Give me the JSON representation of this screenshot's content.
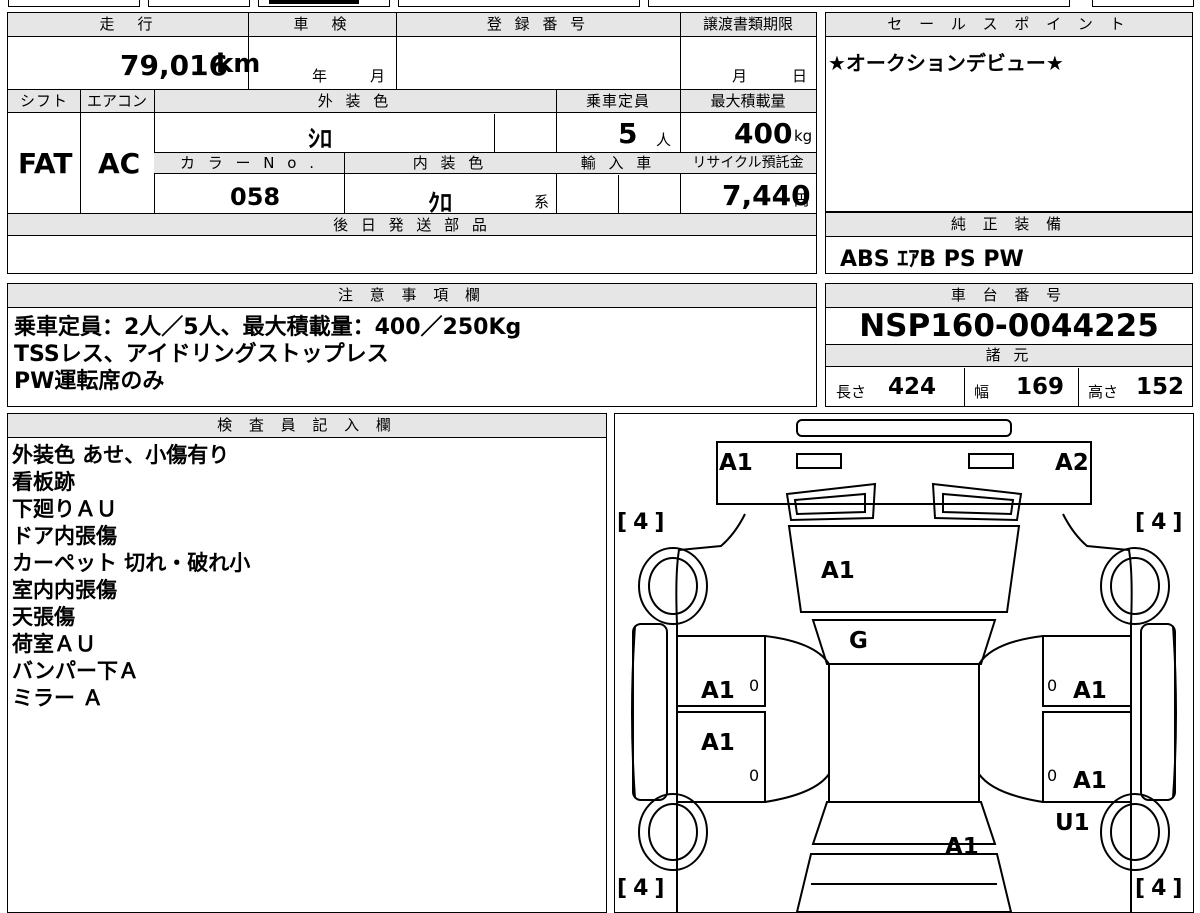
{
  "top_table": {
    "headers": {
      "mileage": "走　行",
      "inspection": "車　検",
      "registration": "登 録 番 号",
      "transfer_deadline": "譲渡書類期限",
      "shift": "シフト",
      "aircon": "エアコン",
      "exterior_color": "外 装 色",
      "capacity": "乗車定員",
      "max_load": "最大積載量",
      "color_no": "カ ラ ー N o .",
      "interior_color": "内 装 色",
      "import": "輸 入 車",
      "recycle_fee": "リサイクル預託金",
      "delivery_parts": "後 日 発 送 部 品"
    },
    "values": {
      "mileage": "79,016",
      "mileage_unit": "km",
      "year_unit": "年",
      "month_unit": "月",
      "transfer_month": "月",
      "transfer_day": "日",
      "shift": "FAT",
      "aircon": "AC",
      "exterior_color": "ｼﾛ",
      "capacity": "5",
      "capacity_unit": "人",
      "max_load": "400",
      "max_load_unit": "kg",
      "color_no": "058",
      "interior_color": "ｸﾛ",
      "interior_suffix": "系",
      "recycle_fee": "7,440",
      "recycle_unit": "円"
    }
  },
  "sales_point": {
    "header": "セ ー ル ス ポ イ ン ト",
    "text": "★オークションデビュー★"
  },
  "genuine_equipment": {
    "header": "純 正 装 備",
    "text": "ABS ｴｱB PS PW"
  },
  "notes": {
    "header": "注 意 事 項 欄",
    "lines": [
      "乗車定員：2人／5人、最大積載量：400／250Kg",
      "TSSレス、アイドリングストップレス",
      "PW運転席のみ"
    ]
  },
  "chassis": {
    "header": "車 台 番 号",
    "number": "NSP160-0044225"
  },
  "specs": {
    "header": "諸 元",
    "length_label": "長さ",
    "length": "424",
    "width_label": "幅",
    "width": "169",
    "height_label": "高さ",
    "height": "152"
  },
  "inspector": {
    "header": "検 査 員 記 入 欄",
    "lines": [
      "外装色 あせ、小傷有り",
      "看板跡",
      "下廻りＡＵ",
      "ドア内張傷",
      "カーペット 切れ・破れ小",
      "室内内張傷",
      "天張傷",
      "荷室ＡＵ",
      "バンパー下Ａ",
      "ミラー Ａ"
    ]
  },
  "car_map": {
    "labels": {
      "front_left": "A1",
      "front_right": "A2",
      "hood": "A1",
      "windshield": "G",
      "front_door_left": "A1",
      "front_door_right": "A1",
      "rear_door_left": "A1",
      "rear_door_right": "A1",
      "rear_wheel_right": "U1",
      "trunk": "A1",
      "tire_fl": "4",
      "tire_fr": "4",
      "tire_rl": "4",
      "tire_rr": "4",
      "zero_fl": "0",
      "zero_fr": "0",
      "zero_rl": "0",
      "zero_rr": "0"
    }
  }
}
